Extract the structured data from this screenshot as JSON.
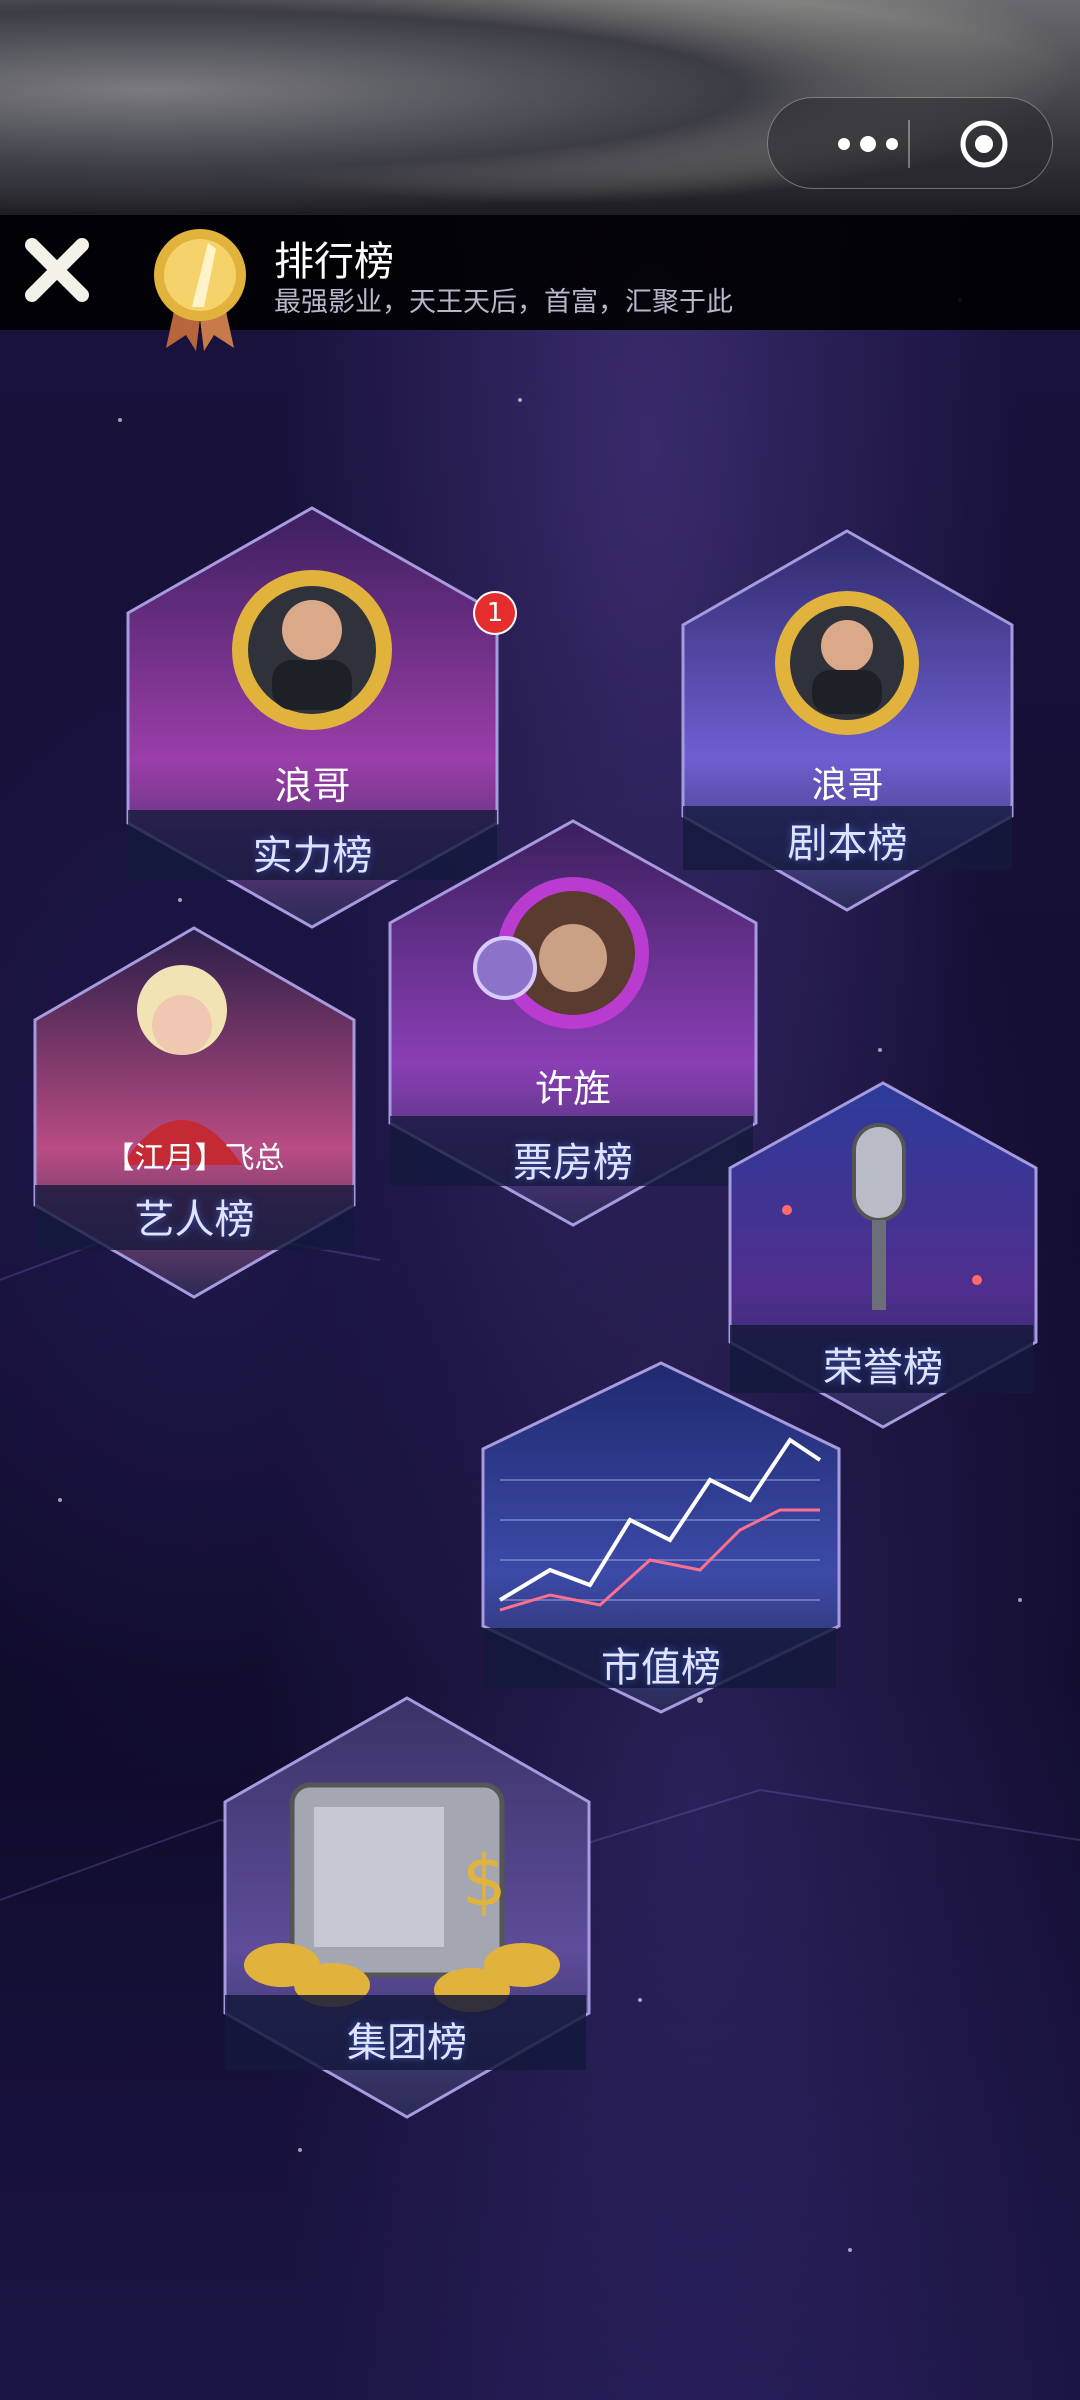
{
  "header": {
    "title": "排行榜",
    "subtitle": "最强影业，天王天后，首富，汇聚于此"
  },
  "notification_count": "1",
  "tiles": {
    "strength": {
      "label": "实力榜",
      "player": "浪哥"
    },
    "script": {
      "label": "剧本榜",
      "player": "浪哥"
    },
    "boxoffice": {
      "label": "票房榜",
      "player": "许旌"
    },
    "artist": {
      "label": "艺人榜",
      "player": "【江月】飞总"
    },
    "honor": {
      "label": "荣誉榜"
    },
    "market": {
      "label": "市值榜"
    },
    "group": {
      "label": "集团榜"
    }
  },
  "colors": {
    "hex_border": "#a79adf",
    "accent_gold": "#e2b33c",
    "badge_red": "#e52d2d"
  }
}
